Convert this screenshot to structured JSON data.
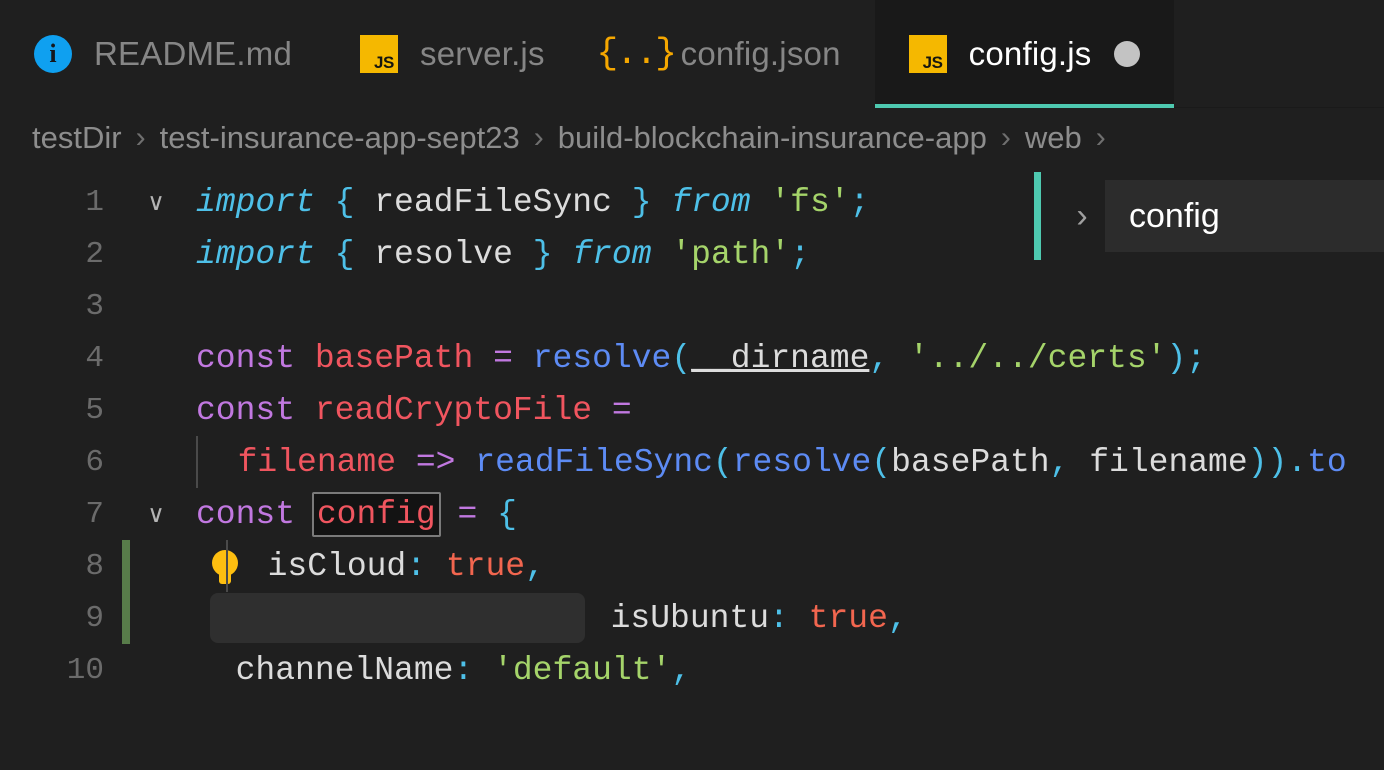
{
  "theme": {
    "background": "#1f1f1f",
    "active_tab_background": "#191919",
    "active_tab_underline": "#4ec9b0",
    "accent_teal": "#4ec9b0",
    "gutter_modified": "#587c4a",
    "selection": "#2f2f2f",
    "keyword": "#4ec0e8",
    "declaration": "#c178e0",
    "variable": "#f0555f",
    "function": "#5d8bf4",
    "string": "#a5d46a",
    "boolean": "#f2664f",
    "plain_text": "#dcdcdc",
    "line_number": "#6b6b6b",
    "breadcrumb_text": "#8a8a8a"
  },
  "tabs": [
    {
      "label": "README.md",
      "icon": "markdown-info-icon",
      "icon_text": "i",
      "active": false,
      "dirty": false
    },
    {
      "label": "server.js",
      "icon": "javascript-icon",
      "icon_text": "JS",
      "active": false,
      "dirty": false
    },
    {
      "label": "config.json",
      "icon": "json-icon",
      "icon_text": "{..}",
      "active": false,
      "dirty": false
    },
    {
      "label": "config.js",
      "icon": "javascript-icon",
      "icon_text": "JS",
      "active": true,
      "dirty": true
    }
  ],
  "breadcrumb": {
    "separator": "›",
    "items": [
      {
        "label": "testDir"
      },
      {
        "label": "test-insurance-app-sept23"
      },
      {
        "label": "build-blockchain-insurance-app"
      },
      {
        "label": "web"
      }
    ],
    "trailing_separator": "›"
  },
  "popup": {
    "chevron": "›",
    "symbol_label": "config"
  },
  "editor": {
    "filename": "config.js",
    "lines": [
      {
        "number": "1",
        "fold": "∨",
        "modified": false,
        "selected": false,
        "bulb": false,
        "tokens": [
          {
            "text": "import",
            "cls": "t-kw"
          },
          {
            "text": " ",
            "cls": "t-plain"
          },
          {
            "text": "{",
            "cls": "t-punc"
          },
          {
            "text": " readFileSync ",
            "cls": "t-plain"
          },
          {
            "text": "}",
            "cls": "t-punc"
          },
          {
            "text": " ",
            "cls": "t-plain"
          },
          {
            "text": "from",
            "cls": "t-kw"
          },
          {
            "text": " ",
            "cls": "t-plain"
          },
          {
            "text": "'fs'",
            "cls": "t-str"
          },
          {
            "text": ";",
            "cls": "t-punc"
          }
        ]
      },
      {
        "number": "2",
        "fold": "",
        "modified": false,
        "selected": false,
        "bulb": false,
        "tokens": [
          {
            "text": "import",
            "cls": "t-kw"
          },
          {
            "text": " ",
            "cls": "t-plain"
          },
          {
            "text": "{",
            "cls": "t-punc"
          },
          {
            "text": " resolve ",
            "cls": "t-plain"
          },
          {
            "text": "}",
            "cls": "t-punc"
          },
          {
            "text": " ",
            "cls": "t-plain"
          },
          {
            "text": "from",
            "cls": "t-kw"
          },
          {
            "text": " ",
            "cls": "t-plain"
          },
          {
            "text": "'path'",
            "cls": "t-str"
          },
          {
            "text": ";",
            "cls": "t-punc"
          }
        ]
      },
      {
        "number": "3",
        "fold": "",
        "modified": false,
        "selected": false,
        "bulb": false,
        "tokens": []
      },
      {
        "number": "4",
        "fold": "",
        "modified": false,
        "selected": false,
        "bulb": false,
        "tokens": [
          {
            "text": "const",
            "cls": "t-decl"
          },
          {
            "text": " ",
            "cls": "t-plain"
          },
          {
            "text": "basePath",
            "cls": "t-var"
          },
          {
            "text": " ",
            "cls": "t-plain"
          },
          {
            "text": "=",
            "cls": "t-op"
          },
          {
            "text": " ",
            "cls": "t-plain"
          },
          {
            "text": "resolve",
            "cls": "t-fn"
          },
          {
            "text": "(",
            "cls": "t-punc"
          },
          {
            "text": "__dirname",
            "cls": "t-under"
          },
          {
            "text": ",",
            "cls": "t-punc"
          },
          {
            "text": " ",
            "cls": "t-plain"
          },
          {
            "text": "'../../certs'",
            "cls": "t-str"
          },
          {
            "text": ")",
            "cls": "t-punc"
          },
          {
            "text": ";",
            "cls": "t-punc"
          }
        ]
      },
      {
        "number": "5",
        "fold": "",
        "modified": false,
        "selected": false,
        "bulb": false,
        "tokens": [
          {
            "text": "const",
            "cls": "t-decl"
          },
          {
            "text": " ",
            "cls": "t-plain"
          },
          {
            "text": "readCryptoFile",
            "cls": "t-var"
          },
          {
            "text": " ",
            "cls": "t-plain"
          },
          {
            "text": "=",
            "cls": "t-op"
          }
        ]
      },
      {
        "number": "6",
        "fold": "",
        "modified": false,
        "selected": false,
        "bulb": false,
        "indent": 1,
        "tokens": [
          {
            "text": "  ",
            "cls": "t-plain"
          },
          {
            "text": "filename",
            "cls": "t-var"
          },
          {
            "text": " ",
            "cls": "t-plain"
          },
          {
            "text": "=>",
            "cls": "t-op"
          },
          {
            "text": " ",
            "cls": "t-plain"
          },
          {
            "text": "readFileSync",
            "cls": "t-fn"
          },
          {
            "text": "(",
            "cls": "t-punc"
          },
          {
            "text": "resolve",
            "cls": "t-fn"
          },
          {
            "text": "(",
            "cls": "t-punc"
          },
          {
            "text": "basePath",
            "cls": "t-plain"
          },
          {
            "text": ",",
            "cls": "t-punc"
          },
          {
            "text": " ",
            "cls": "t-plain"
          },
          {
            "text": "filename",
            "cls": "t-plain"
          },
          {
            "text": "))",
            "cls": "t-punc"
          },
          {
            "text": ".",
            "cls": "t-punc"
          },
          {
            "text": "to",
            "cls": "t-fn"
          }
        ]
      },
      {
        "number": "7",
        "fold": "∨",
        "modified": false,
        "selected": false,
        "bulb": false,
        "tokens": [
          {
            "text": "const",
            "cls": "t-decl"
          },
          {
            "text": " ",
            "cls": "t-plain"
          },
          {
            "text": "config",
            "cls": "t-var",
            "highlight": true
          },
          {
            "text": " ",
            "cls": "t-plain"
          },
          {
            "text": "=",
            "cls": "t-op"
          },
          {
            "text": " ",
            "cls": "t-plain"
          },
          {
            "text": "{",
            "cls": "t-punc"
          }
        ]
      },
      {
        "number": "8",
        "fold": "",
        "modified": true,
        "selected": false,
        "bulb": true,
        "indent": 1,
        "tokens": [
          {
            "text": "  ",
            "cls": "t-plain"
          },
          {
            "text": "isCloud",
            "cls": "t-plain"
          },
          {
            "text": ":",
            "cls": "t-punc"
          },
          {
            "text": " ",
            "cls": "t-plain"
          },
          {
            "text": "true",
            "cls": "t-bool"
          },
          {
            "text": ",",
            "cls": "t-punc"
          }
        ]
      },
      {
        "number": "9",
        "fold": "",
        "modified": true,
        "selected": true,
        "selection_width": 375,
        "bulb": false,
        "tokens": [
          {
            "text": "  ",
            "cls": "t-plain"
          },
          {
            "text": "isUbuntu",
            "cls": "t-plain"
          },
          {
            "text": ":",
            "cls": "t-punc"
          },
          {
            "text": " ",
            "cls": "t-plain"
          },
          {
            "text": "true",
            "cls": "t-bool"
          },
          {
            "text": ",",
            "cls": "t-punc"
          }
        ]
      },
      {
        "number": "10",
        "fold": "",
        "modified": false,
        "selected": false,
        "bulb": false,
        "tokens": [
          {
            "text": "  ",
            "cls": "t-plain"
          },
          {
            "text": "channelName",
            "cls": "t-plain"
          },
          {
            "text": ":",
            "cls": "t-punc"
          },
          {
            "text": " ",
            "cls": "t-plain"
          },
          {
            "text": "'default'",
            "cls": "t-str"
          },
          {
            "text": ",",
            "cls": "t-punc"
          }
        ]
      }
    ]
  }
}
